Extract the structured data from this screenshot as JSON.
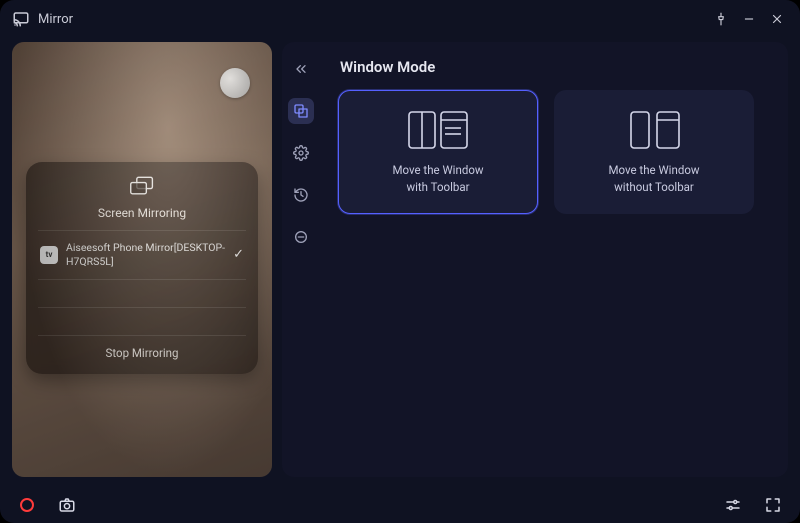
{
  "titlebar": {
    "app_name": "Mirror"
  },
  "preview": {
    "mirror_card": {
      "title": "Screen Mirroring",
      "device_name": "Aiseesoft Phone Mirror[DESKTOP-H7QRS5L]",
      "app_badge": "tv",
      "stop_label": "Stop Mirroring"
    }
  },
  "settings": {
    "section_title": "Window Mode",
    "modes": [
      {
        "label_line1": "Move the Window",
        "label_line2": "with Toolbar",
        "selected": true
      },
      {
        "label_line1": "Move the Window",
        "label_line2": "without Toolbar",
        "selected": false
      }
    ]
  }
}
